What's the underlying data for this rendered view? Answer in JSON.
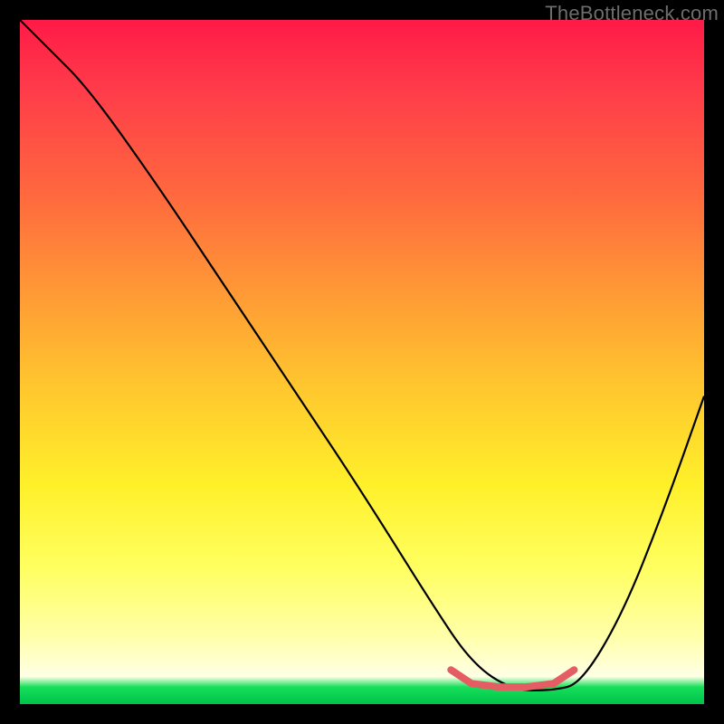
{
  "watermark": "TheBottleneck.com",
  "chart_data": {
    "type": "line",
    "title": "",
    "xlabel": "",
    "ylabel": "",
    "xlim": [
      0,
      100
    ],
    "ylim": [
      0,
      100
    ],
    "grid": false,
    "series": [
      {
        "name": "curve",
        "color": "#000000",
        "x": [
          0,
          4,
          10,
          20,
          30,
          40,
          50,
          60,
          66,
          72,
          78,
          82,
          88,
          94,
          100
        ],
        "y": [
          100,
          96,
          90,
          76,
          61,
          46,
          31,
          15,
          6,
          2,
          2,
          3,
          13,
          28,
          45
        ]
      }
    ],
    "highlight": {
      "name": "bottom-segment",
      "color": "#e35d63",
      "x": [
        63,
        66,
        70,
        74,
        78,
        81
      ],
      "y": [
        5,
        3,
        2.5,
        2.5,
        3,
        5
      ]
    },
    "background_gradient": {
      "stops": [
        {
          "pos": 0,
          "color": "#ff1a47"
        },
        {
          "pos": 0.26,
          "color": "#ff6a3e"
        },
        {
          "pos": 0.54,
          "color": "#ffc82e"
        },
        {
          "pos": 0.8,
          "color": "#ffff60"
        },
        {
          "pos": 0.96,
          "color": "#ffffe6"
        },
        {
          "pos": 1.0,
          "color": "#00c24a"
        }
      ]
    }
  }
}
